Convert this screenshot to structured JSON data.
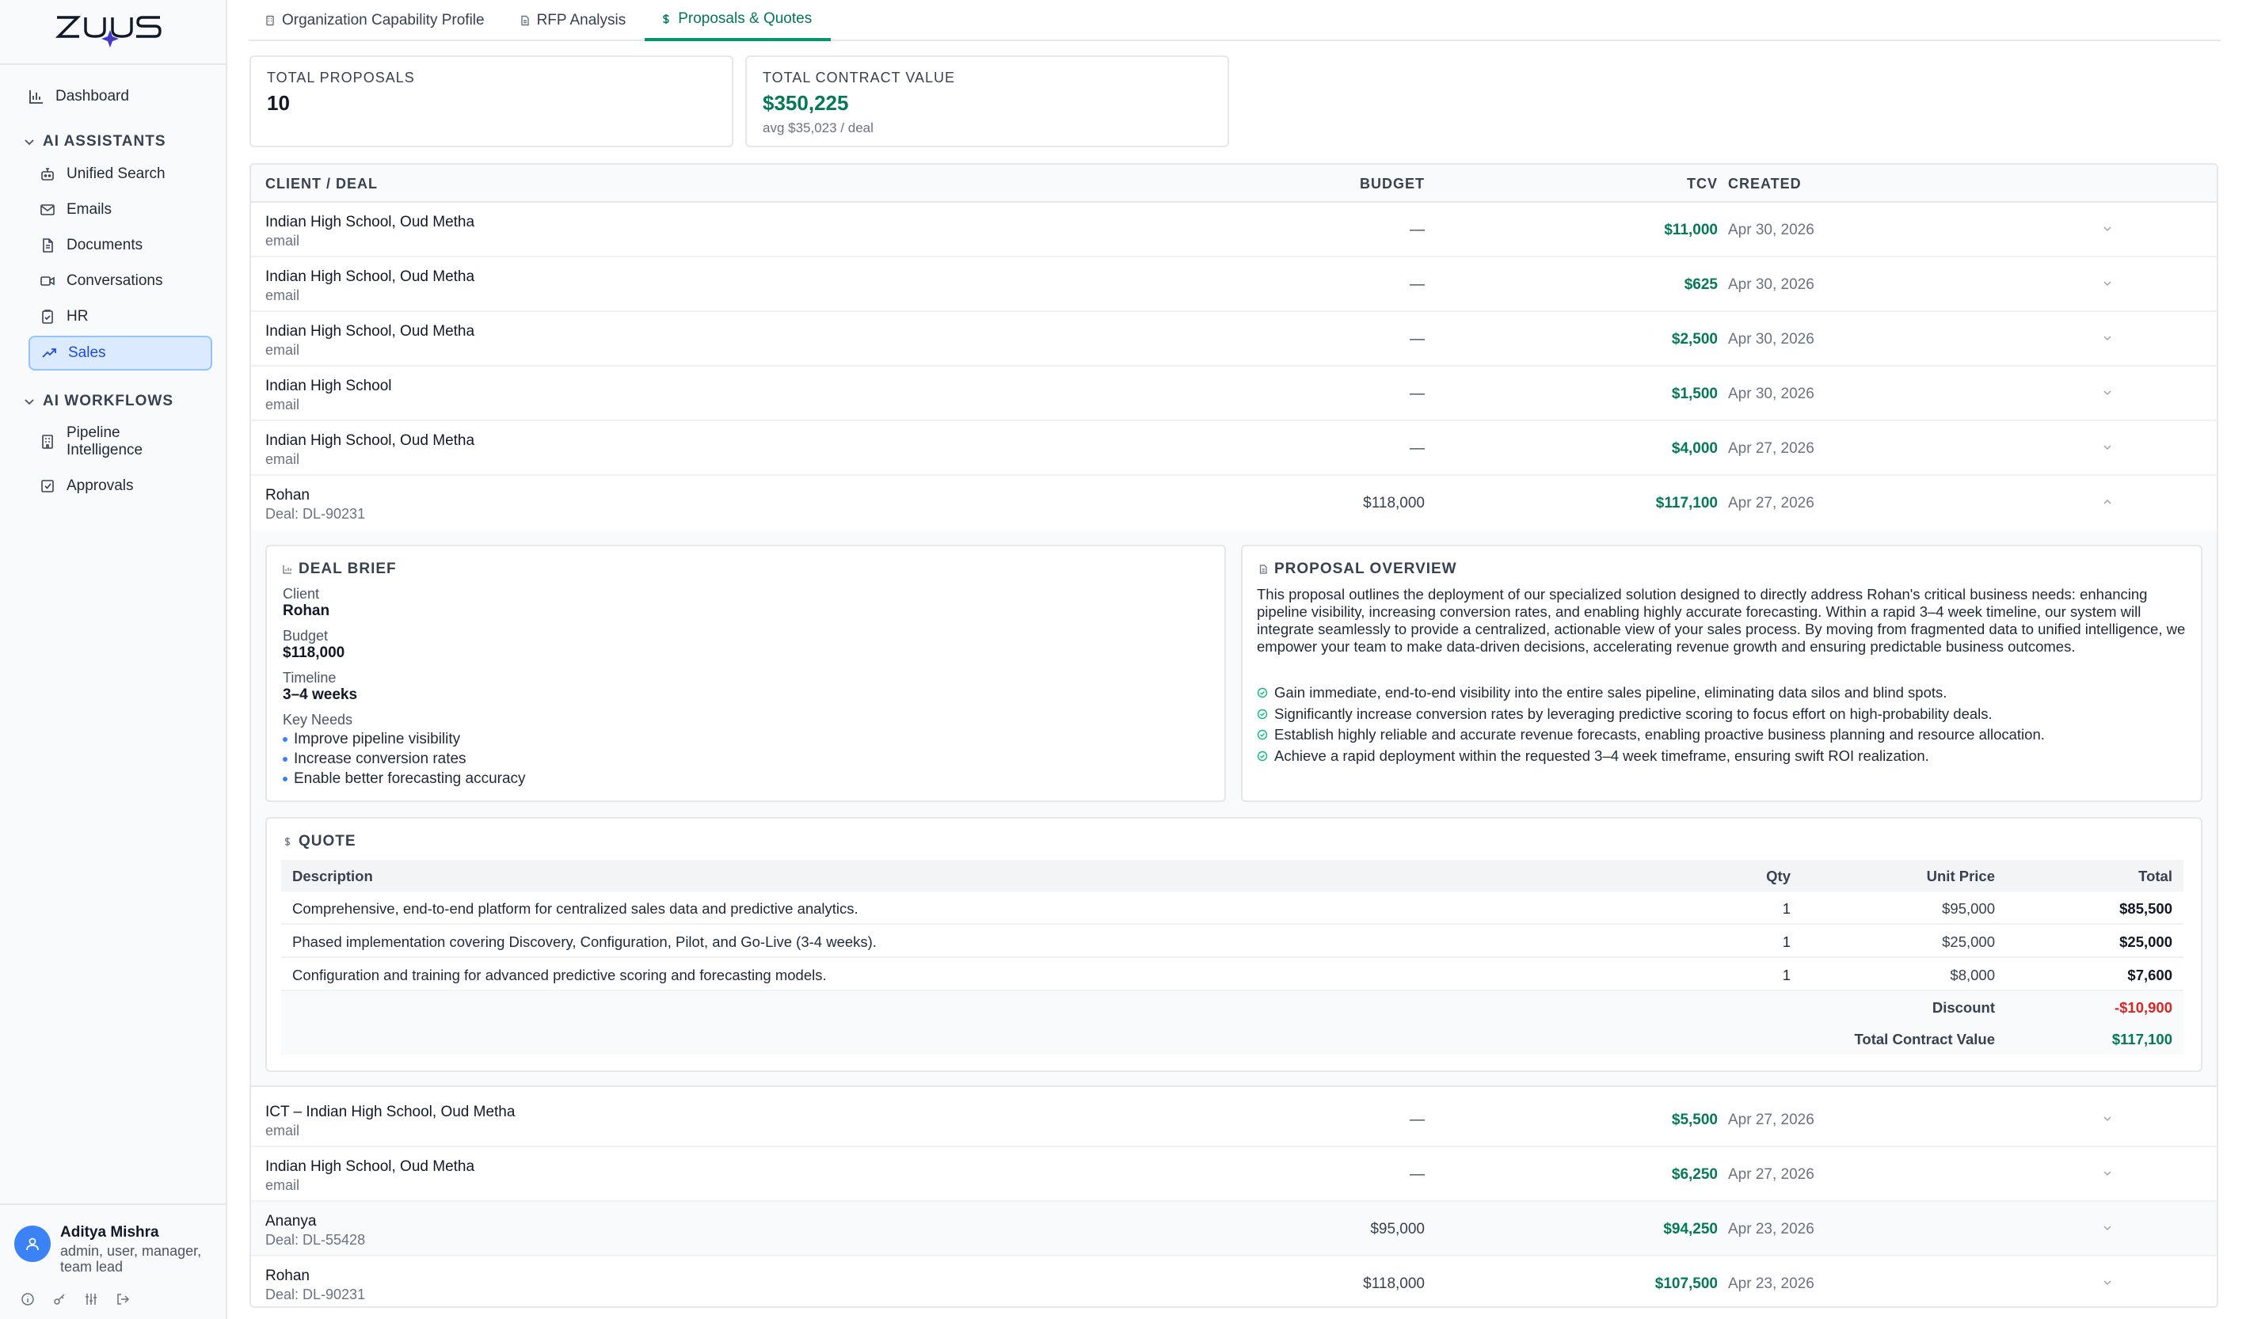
{
  "app": {
    "logo_text": "ZUUS"
  },
  "sidebar": {
    "dashboard": "Dashboard",
    "ai_assistants": {
      "heading": "AI ASSISTANTS",
      "items": [
        "Unified Search",
        "Emails",
        "Documents",
        "Conversations",
        "HR",
        "Sales"
      ]
    },
    "ai_workflows": {
      "heading": "AI WORKFLOWS",
      "items": [
        "Pipeline Intelligence",
        "Approvals"
      ]
    },
    "active_item": "Sales"
  },
  "user": {
    "name": "Aditya Mishra",
    "roles": "admin, user, manager, team lead"
  },
  "tabs": [
    {
      "label": "Organization Capability Profile",
      "active": false
    },
    {
      "label": "RFP Analysis",
      "active": false
    },
    {
      "label": "Proposals & Quotes",
      "active": true
    }
  ],
  "stats": {
    "total_proposals_label": "TOTAL PROPOSALS",
    "total_proposals_value": "10",
    "tcv_label": "TOTAL CONTRACT VALUE",
    "tcv_value": "$350,225",
    "tcv_sub": "avg $35,023 / deal"
  },
  "table": {
    "headers": {
      "client": "CLIENT / DEAL",
      "budget": "BUDGET",
      "tcv": "TCV",
      "created": "CREATED"
    },
    "rows": [
      {
        "client": "Indian High School, Oud Metha",
        "sub": "email",
        "budget": "—",
        "tcv": "$11,000",
        "created": "Apr 30, 2026"
      },
      {
        "client": "Indian High School, Oud Metha",
        "sub": "email",
        "budget": "—",
        "tcv": "$625",
        "created": "Apr 30, 2026"
      },
      {
        "client": "Indian High School, Oud Metha",
        "sub": "email",
        "budget": "—",
        "tcv": "$2,500",
        "created": "Apr 30, 2026"
      },
      {
        "client": "Indian High School",
        "sub": "email",
        "budget": "—",
        "tcv": "$1,500",
        "created": "Apr 30, 2026"
      },
      {
        "client": "Indian High School, Oud Metha",
        "sub": "email",
        "budget": "—",
        "tcv": "$4,000",
        "created": "Apr 27, 2026"
      },
      {
        "client": "Rohan",
        "sub": "Deal: DL-90231",
        "budget": "$118,000",
        "tcv": "$117,100",
        "created": "Apr 27, 2026"
      },
      {
        "client": "ICT – Indian High School, Oud Metha",
        "sub": "email",
        "budget": "—",
        "tcv": "$5,500",
        "created": "Apr 27, 2026"
      },
      {
        "client": "Indian High School, Oud Metha",
        "sub": "email",
        "budget": "—",
        "tcv": "$6,250",
        "created": "Apr 27, 2026"
      },
      {
        "client": "Ananya",
        "sub": "Deal: DL-55428",
        "budget": "$95,000",
        "tcv": "$94,250",
        "created": "Apr 23, 2026"
      },
      {
        "client": "Rohan",
        "sub": "Deal: DL-90231",
        "budget": "$118,000",
        "tcv": "$107,500",
        "created": "Apr 23, 2026"
      }
    ]
  },
  "deal_brief": {
    "title": "DEAL BRIEF",
    "client_label": "Client",
    "client": "Rohan",
    "budget_label": "Budget",
    "budget": "$118,000",
    "timeline_label": "Timeline",
    "timeline": "3–4 weeks",
    "needs_label": "Key Needs",
    "needs": [
      "Improve pipeline visibility",
      "Increase conversion rates",
      "Enable better forecasting accuracy"
    ]
  },
  "proposal_overview": {
    "title": "PROPOSAL OVERVIEW",
    "text": "This proposal outlines the deployment of our specialized solution designed to directly address Rohan's critical business needs: enhancing pipeline visibility, increasing conversion rates, and enabling highly accurate forecasting. Within a rapid 3–4 week timeline, our system will integrate seamlessly to provide a centralized, actionable view of your sales process. By moving from fragmented data to unified intelligence, we empower your team to make data-driven decisions, accelerating revenue growth and ensuring predictable business outcomes.",
    "bullets": [
      "Gain immediate, end-to-end visibility into the entire sales pipeline, eliminating data silos and blind spots.",
      "Significantly increase conversion rates by leveraging predictive scoring to focus effort on high-probability deals.",
      "Establish highly reliable and accurate revenue forecasts, enabling proactive business planning and resource allocation.",
      "Achieve a rapid deployment within the requested 3–4 week timeframe, ensuring swift ROI realization."
    ]
  },
  "quote": {
    "title": "QUOTE",
    "headers": {
      "description": "Description",
      "qty": "Qty",
      "unit_price": "Unit Price",
      "total": "Total"
    },
    "lines": [
      {
        "description": "Comprehensive, end-to-end platform for centralized sales data and predictive analytics.",
        "qty": "1",
        "unit_price": "$95,000",
        "total": "$85,500"
      },
      {
        "description": "Phased implementation covering Discovery, Configuration, Pilot, and Go-Live (3-4 weeks).",
        "qty": "1",
        "unit_price": "$25,000",
        "total": "$25,000"
      },
      {
        "description": "Configuration and training for advanced predictive scoring and forecasting models.",
        "qty": "1",
        "unit_price": "$8,000",
        "total": "$7,600"
      }
    ],
    "discount_label": "Discount",
    "discount": "-$10,900",
    "tcv_label": "Total Contract Value",
    "tcv": "$117,100"
  },
  "colors": {
    "accent": "#047857",
    "active_nav": "#1d4ed8",
    "discount": "#dc2626",
    "avatar": "#3b82f6"
  }
}
